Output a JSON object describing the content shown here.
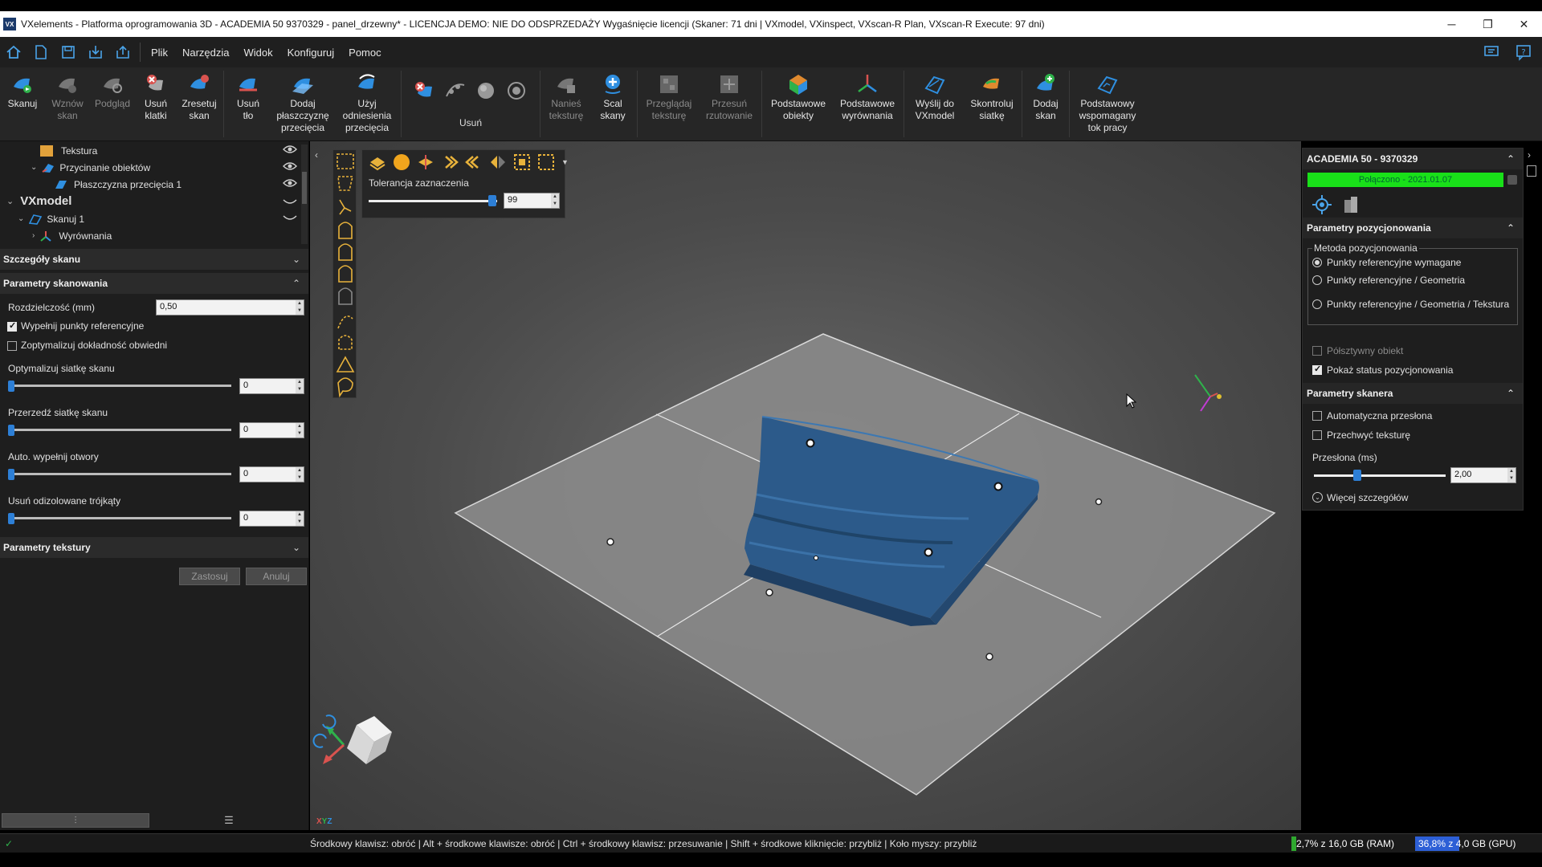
{
  "window": {
    "app_icon": "VX",
    "title": "VXelements - Platforma oprogramowania 3D - ACADEMIA 50 9370329 - panel_drzewny* - LICENCJA DEMO: NIE DO ODSPRZEDAŻY Wygaśnięcie licencji (Skaner: 71 dni | VXmodel, VXinspect, VXscan-R Plan, VXscan-R Execute: 97 dni)",
    "minimize": "─",
    "restore": "❐",
    "close": "✕"
  },
  "menu": {
    "items": [
      "Plik",
      "Narzędzia",
      "Widok",
      "Konfiguruj",
      "Pomoc"
    ]
  },
  "ribbon": {
    "buttons": [
      {
        "label": "Skanuj",
        "icon": "scan-icon",
        "color": "#2f8fe0",
        "disabled": false
      },
      {
        "label": "Wznów skan",
        "icon": "resume-scan-icon",
        "color": "#777777",
        "disabled": true
      },
      {
        "label": "Podgląd",
        "icon": "preview-icon",
        "color": "#777777",
        "disabled": true
      },
      {
        "label": "Usuń klatki",
        "icon": "delete-frames-icon",
        "color": "#d9534f",
        "disabled": false
      },
      {
        "label": "Zresetuj skan",
        "icon": "reset-scan-icon",
        "color": "#2f8fe0",
        "disabled": false
      },
      {
        "label": "Usuń tło",
        "icon": "remove-background-icon",
        "color": "#2f8fe0",
        "disabled": false
      },
      {
        "label": "Dodaj płaszczyznę przecięcia",
        "icon": "add-cutting-plane-icon",
        "color": "#2f8fe0",
        "disabled": false
      },
      {
        "label": "Użyj odniesienia przecięcia",
        "icon": "use-cut-reference-icon",
        "color": "#2f8fe0",
        "disabled": false
      }
    ],
    "delete_group_label": "Usuń",
    "buttons2": [
      {
        "label": "Nanieś teksturę",
        "icon": "apply-texture-icon",
        "color": "#777777",
        "disabled": true
      },
      {
        "label": "Scal skany",
        "icon": "merge-scans-icon",
        "color": "#2f8fe0",
        "disabled": false
      },
      {
        "label": "Przeglądaj teksturę",
        "icon": "browse-texture-icon",
        "color": "#777777",
        "disabled": true
      },
      {
        "label": "Przesuń rzutowanie",
        "icon": "move-projection-icon",
        "color": "#777777",
        "disabled": true
      },
      {
        "label": "Podstawowe obiekty",
        "icon": "basic-entities-icon",
        "color": "#e08a2f",
        "disabled": false
      },
      {
        "label": "Podstawowe wyrównania",
        "icon": "basic-alignments-icon",
        "color": "#d9534f",
        "disabled": false
      },
      {
        "label": "Wyślij do VXmodel",
        "icon": "send-to-vxmodel-icon",
        "color": "#2f8fe0",
        "disabled": false
      },
      {
        "label": "Skontroluj siatkę",
        "icon": "inspect-mesh-icon",
        "color": "#e08a2f",
        "disabled": false
      },
      {
        "label": "Dodaj skan",
        "icon": "add-scan-icon",
        "color": "#2f8fe0",
        "disabled": false
      },
      {
        "label": "Podstawowy wspomagany tok pracy",
        "icon": "guided-workflow-icon",
        "color": "#2f8fe0",
        "disabled": false
      }
    ]
  },
  "tree": {
    "items": [
      {
        "label": "Tekstura",
        "level": 3,
        "icon": "texture-icon",
        "visible": true
      },
      {
        "label": "Przycinanie obiektów",
        "level": 2,
        "icon": "trim-objects-icon",
        "visible": true
      },
      {
        "label": "Płaszczyzna przecięcia 1",
        "level": 3,
        "icon": "cutting-plane-icon",
        "visible": true
      },
      {
        "label": "VXmodel",
        "level": 0,
        "icon": "",
        "visible": false
      },
      {
        "label": "Skanuj 1",
        "level": 1,
        "icon": "scan-icon",
        "visible": false
      },
      {
        "label": "Wyrównania",
        "level": 2,
        "icon": "alignments-icon",
        "visible": false
      }
    ]
  },
  "scan_details": {
    "title": "Szczegóły skanu",
    "scan_params": {
      "title": "Parametry skanowania",
      "resolution_label": "Rozdzielczość (mm)",
      "resolution_value": "0,50",
      "fill_targets_label": "Wypełnij punkty referencyjne",
      "fill_targets_checked": true,
      "optimize_contour_label": "Zoptymalizuj dokładność obwiedni",
      "optimize_contour_checked": false,
      "sliders": [
        {
          "label": "Optymalizuj siatkę skanu",
          "value": "0"
        },
        {
          "label": "Przerzedź siatkę skanu",
          "value": "0"
        },
        {
          "label": "Auto. wypełnij otwory",
          "value": "0"
        },
        {
          "label": "Usuń odizolowane trójkąty",
          "value": "0"
        }
      ]
    },
    "texture_params": {
      "title": "Parametry tekstury"
    },
    "apply_label": "Zastosuj",
    "cancel_label": "Anuluj"
  },
  "selection_toolbar": {
    "tolerance_label": "Tolerancja zaznaczenia",
    "tolerance_value": "99",
    "tolerance_fraction": 0.99
  },
  "scanner_panel": {
    "device": "ACADEMIA 50 - 9370329",
    "status": "Połączono - 2021.01.07",
    "status_color": "#19e019",
    "positioning": {
      "title": "Parametry pozycjonowania",
      "method_label": "Metoda pozycjonowania",
      "options": [
        "Punkty referencyjne wymagane",
        "Punkty referencyjne / Geometria",
        "Punkty referencyjne / Geometria / Tekstura"
      ],
      "semi_rigid_label": "Półsztywny obiekt",
      "semi_rigid_checked": false,
      "semi_rigid_disabled": true,
      "show_status_label": "Pokaż status pozycjonowania",
      "show_status_checked": true
    },
    "scanner_params": {
      "title": "Parametry skanera",
      "auto_shutter_label": "Automatyczna przesłona",
      "auto_shutter_checked": false,
      "capture_texture_label": "Przechwyć teksturę",
      "capture_texture_checked": false,
      "shutter_label": "Przesłona (ms)",
      "shutter_value": "2,00",
      "more_details_label": "Więcej szczegółów"
    }
  },
  "viewport": {
    "axis_label": "XYZ",
    "accent": "#2c5a8a"
  },
  "statusbar": {
    "hint": "Środkowy klawisz: obróć  |  Alt + środkowe klawisze: obróć  |  Ctrl + środkowy klawisz: przesuwanie  |  Shift + środkowe kliknięcie: przybliż  |  Koło myszy: przybliż",
    "ram": "2,7% z 16,0 GB (RAM)",
    "gpu": "36,8% z 4,0 GB (GPU)",
    "ram_fraction": 0.027,
    "gpu_fraction": 0.368
  }
}
